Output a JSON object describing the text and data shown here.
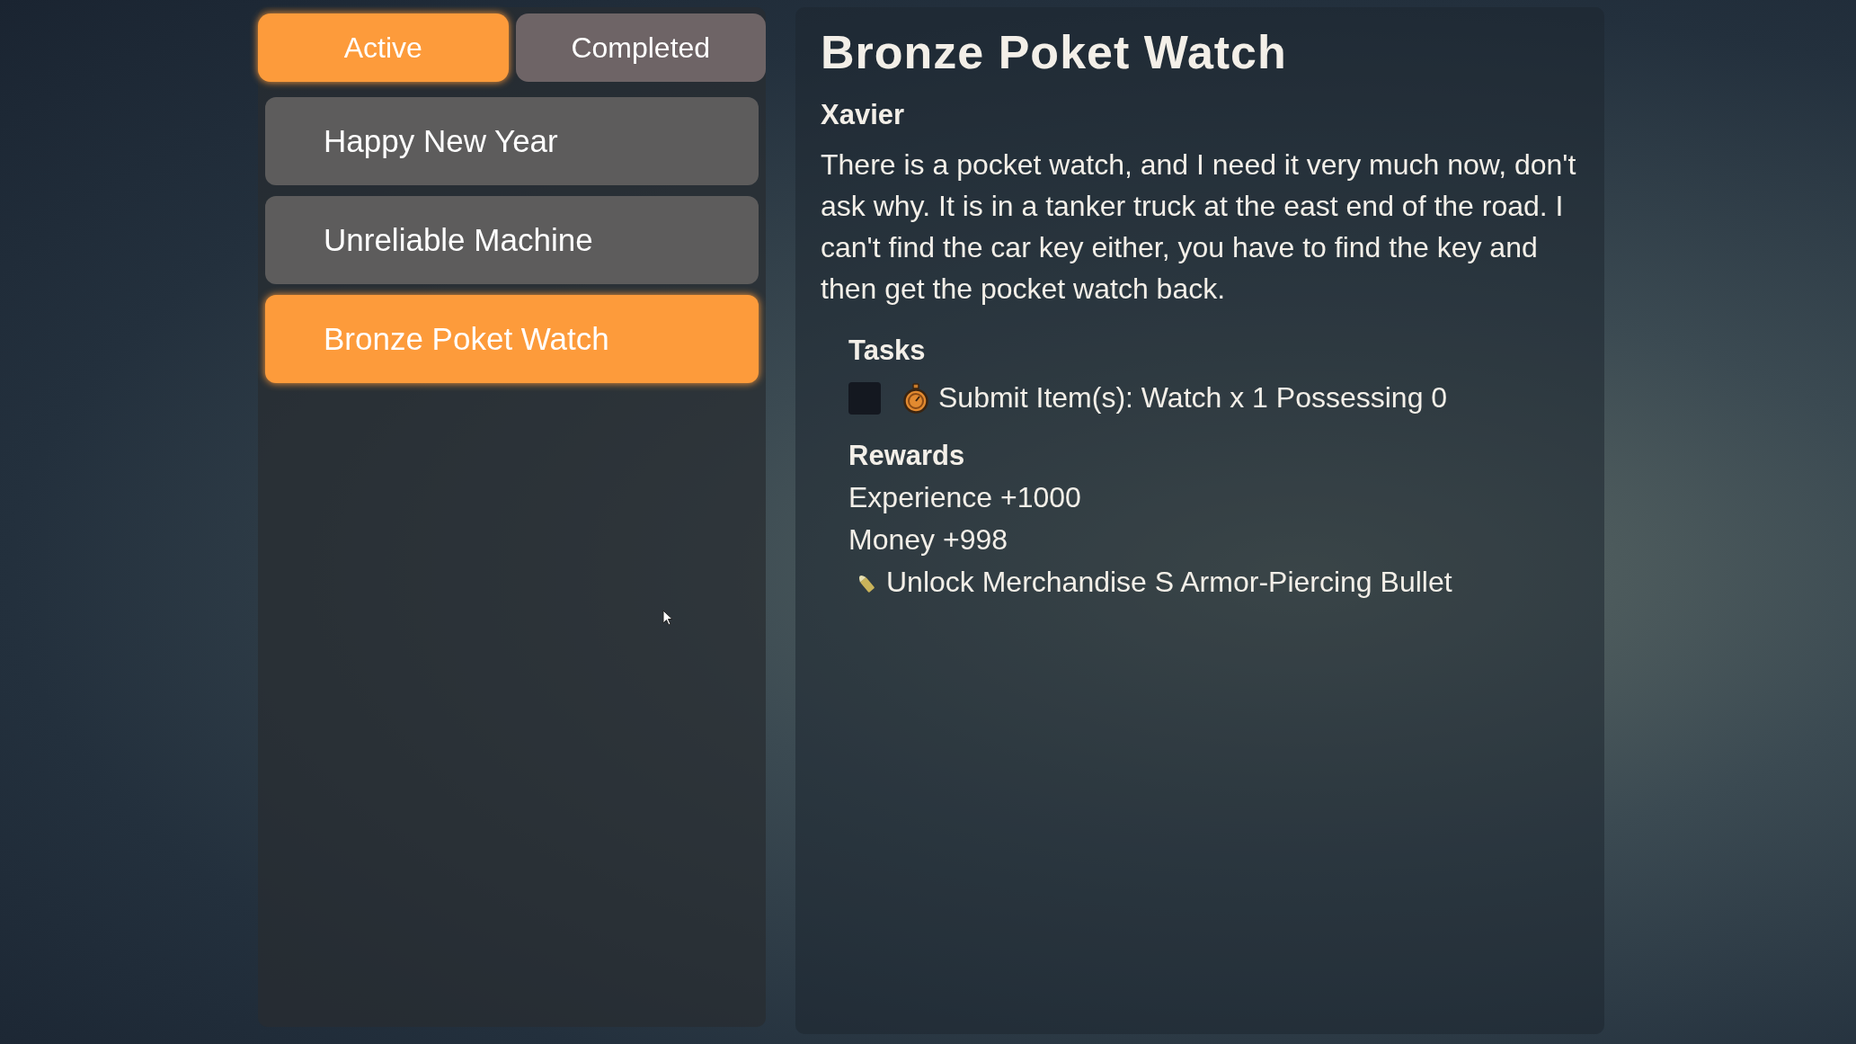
{
  "tabs": [
    {
      "label": "Active",
      "selected": true
    },
    {
      "label": "Completed",
      "selected": false
    }
  ],
  "quests": [
    {
      "title": "Happy New Year",
      "selected": false
    },
    {
      "title": "Unreliable Machine",
      "selected": false
    },
    {
      "title": "Bronze Poket Watch",
      "selected": true
    }
  ],
  "detail": {
    "title": "Bronze Poket Watch",
    "giver": "Xavier",
    "description": "There is a pocket watch, and I need it very much now, don't ask why. It is in a tanker truck at the east end of the road. I can't find the car key either, you have to find the key and then get the pocket watch back.",
    "tasks_heading": "Tasks",
    "tasks": [
      {
        "text": "Submit Item(s): Watch x 1 Possessing 0",
        "checked": false
      }
    ],
    "rewards_heading": "Rewards",
    "rewards": [
      {
        "kind": "text",
        "text": "Experience +1000"
      },
      {
        "kind": "text",
        "text": "Money +998"
      },
      {
        "kind": "unlock",
        "text": "Unlock Merchandise S Armor-Piercing Bullet"
      }
    ]
  }
}
